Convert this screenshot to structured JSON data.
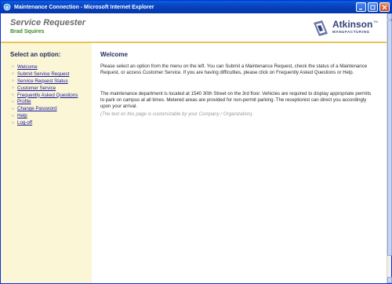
{
  "window": {
    "title": "Maintenance Connection - Microsoft Internet Explorer"
  },
  "header": {
    "app_title": "Service Requester",
    "user_name": "Brad Squires",
    "logo": {
      "word": "Atkinson",
      "tm": "TM",
      "sub": "MANUFACTURING"
    }
  },
  "sidebar": {
    "heading": "Select an option:",
    "items": [
      {
        "label": "Welcome"
      },
      {
        "label": "Submit Service Request"
      },
      {
        "label": "Service Request Status"
      },
      {
        "label": "Customer Service"
      },
      {
        "label": "Frequently Asked Questions"
      },
      {
        "label": "Profile"
      },
      {
        "label": "Change Password"
      },
      {
        "label": "Help"
      },
      {
        "label": "Log-off"
      }
    ]
  },
  "main": {
    "heading": "Welcome",
    "paragraph1": "Please select an option from the menu on the left. You can Submit a Maintenance Request, check the status of a Maintenance Request, or access Customer Service.  If you are having difficulties, please click on Frequently Asked Questions or Help.",
    "paragraph2": "The maintenance department is located at 1540 30th Street on the 3rd floor. Vehicles are required to display appropriate permits to park on campus at all times. Metered areas are provided for non-permit parking. The receptionist can direct you accordingly upon your arrival.",
    "note": "(The text on this page is customizable by your Company / Organization)."
  },
  "colors": {
    "titlebar": "#0842c0",
    "accent_rule": "#e8c35a",
    "sidebar_bg": "#fbf6d5",
    "heading": "#1f2a5e",
    "link": "#1a1aa6",
    "user_name": "#3e8a2a"
  }
}
